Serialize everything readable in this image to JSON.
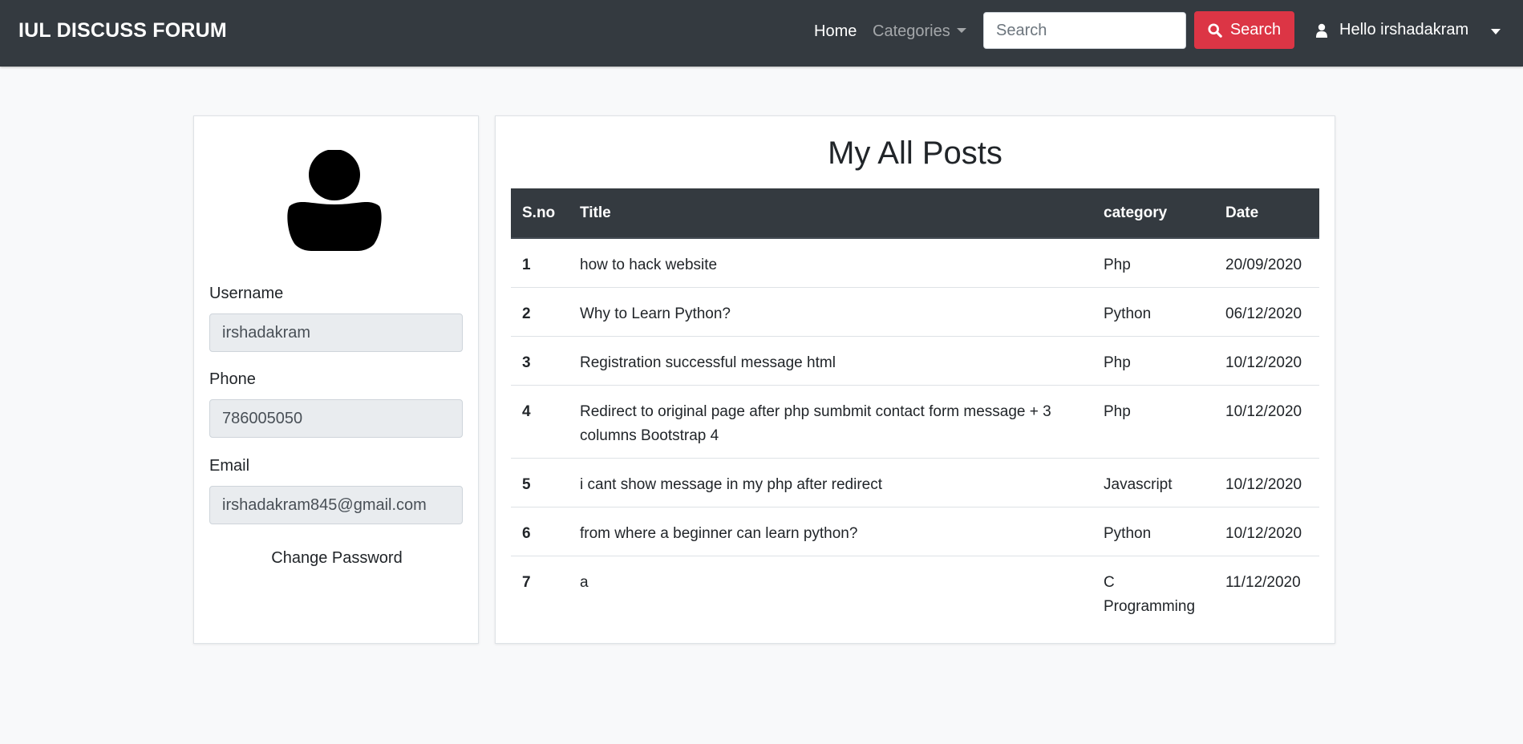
{
  "navbar": {
    "brand": "IUL DISCUSS FORUM",
    "home_label": "Home",
    "categories_label": "Categories",
    "search_placeholder": "Search",
    "search_button_label": "Search",
    "user_greeting": "Hello irshadakram",
    "icons": {
      "search": "search-icon",
      "user": "user-icon",
      "dropdown": "chevron-down-icon"
    }
  },
  "profile": {
    "avatar_icon": "user-avatar-icon",
    "username_label": "Username",
    "username_value": "irshadakram",
    "phone_label": "Phone",
    "phone_value": "786005050",
    "email_label": "Email",
    "email_value": "irshadakram845@gmail.com",
    "change_password_label": "Change Password"
  },
  "posts": {
    "title": "My All Posts",
    "columns": [
      "S.no",
      "Title",
      "category",
      "Date"
    ],
    "rows": [
      {
        "sno": "1",
        "title": "how to hack website",
        "category": "Php",
        "date": "20/09/2020"
      },
      {
        "sno": "2",
        "title": "Why to Learn Python?",
        "category": "Python",
        "date": "06/12/2020"
      },
      {
        "sno": "3",
        "title": "Registration successful message html",
        "category": "Php",
        "date": "10/12/2020"
      },
      {
        "sno": "4",
        "title": "Redirect to original page after php sumbmit contact form message + 3 columns Bootstrap 4",
        "category": "Php",
        "date": "10/12/2020"
      },
      {
        "sno": "5",
        "title": "i cant show message in my php after redirect",
        "category": "Javascript",
        "date": "10/12/2020"
      },
      {
        "sno": "6",
        "title": "from where a beginner can learn python?",
        "category": "Python",
        "date": "10/12/2020"
      },
      {
        "sno": "7",
        "title": "a",
        "category": "C Programming",
        "date": "11/12/2020"
      }
    ]
  },
  "colors": {
    "navbar_bg": "#343a40",
    "search_button": "#dc3545",
    "page_bg": "#f8f9fa",
    "input_readonly_bg": "#e9ecef"
  }
}
